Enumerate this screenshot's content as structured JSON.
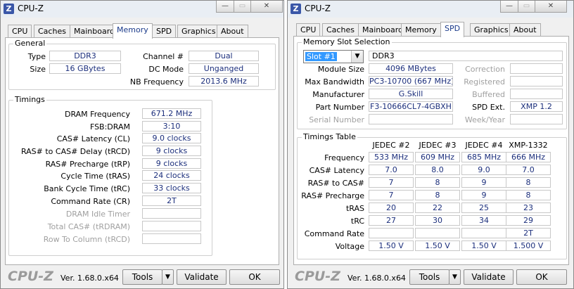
{
  "left": {
    "title": "CPU-Z",
    "tabs": [
      "CPU",
      "Caches",
      "Mainboard",
      "Memory",
      "SPD",
      "Graphics",
      "About"
    ],
    "active_tab": "Memory",
    "general": {
      "label": "General",
      "type_label": "Type",
      "type": "DDR3",
      "size_label": "Size",
      "size": "16 GBytes",
      "channel_label": "Channel #",
      "channel": "Dual",
      "dcmode_label": "DC Mode",
      "dcmode": "Unganged",
      "nbfreq_label": "NB Frequency",
      "nbfreq": "2013.6 MHz"
    },
    "timings": {
      "label": "Timings",
      "rows": [
        {
          "label": "DRAM Frequency",
          "value": "671.2 MHz"
        },
        {
          "label": "FSB:DRAM",
          "value": "3:10"
        },
        {
          "label": "CAS# Latency (CL)",
          "value": "9.0 clocks"
        },
        {
          "label": "RAS# to CAS# Delay (tRCD)",
          "value": "9 clocks"
        },
        {
          "label": "RAS# Precharge (tRP)",
          "value": "9 clocks"
        },
        {
          "label": "Cycle Time (tRAS)",
          "value": "24 clocks"
        },
        {
          "label": "Bank Cycle Time (tRC)",
          "value": "33 clocks"
        },
        {
          "label": "Command Rate (CR)",
          "value": "2T"
        },
        {
          "label": "DRAM Idle Timer",
          "value": ""
        },
        {
          "label": "Total CAS# (tRDRAM)",
          "value": ""
        },
        {
          "label": "Row To Column (tRCD)",
          "value": ""
        }
      ]
    },
    "footer": {
      "brand": "CPU-Z",
      "version": "Ver. 1.68.0.x64",
      "tools": "Tools",
      "validate": "Validate",
      "ok": "OK"
    }
  },
  "right": {
    "title": "CPU-Z",
    "tabs": [
      "CPU",
      "Caches",
      "Mainboard",
      "Memory",
      "SPD",
      "Graphics",
      "About"
    ],
    "active_tab": "SPD",
    "slot": {
      "label": "Memory Slot Selection",
      "selected": "Slot #1",
      "type": "DDR3",
      "module_size_label": "Module Size",
      "module_size": "4096 MBytes",
      "bandwidth_label": "Max Bandwidth",
      "bandwidth": "PC3-10700 (667 MHz)",
      "manufacturer_label": "Manufacturer",
      "manufacturer": "G.Skill",
      "part_label": "Part Number",
      "part": "F3-10666CL7-4GBXH",
      "serial_label": "Serial Number",
      "serial": "",
      "correction_label": "Correction",
      "correction": "",
      "registered_label": "Registered",
      "registered": "",
      "buffered_label": "Buffered",
      "buffered": "",
      "spdext_label": "SPD Ext.",
      "spdext": "XMP 1.2",
      "week_label": "Week/Year",
      "week": ""
    },
    "timings_table": {
      "label": "Timings Table",
      "headers": [
        "JEDEC #2",
        "JEDEC #3",
        "JEDEC #4",
        "XMP-1332"
      ],
      "rows": [
        {
          "label": "Frequency",
          "values": [
            "533 MHz",
            "609 MHz",
            "685 MHz",
            "666 MHz"
          ]
        },
        {
          "label": "CAS# Latency",
          "values": [
            "7.0",
            "8.0",
            "9.0",
            "7.0"
          ]
        },
        {
          "label": "RAS# to CAS#",
          "values": [
            "7",
            "8",
            "9",
            "8"
          ]
        },
        {
          "label": "RAS# Precharge",
          "values": [
            "7",
            "8",
            "9",
            "8"
          ]
        },
        {
          "label": "tRAS",
          "values": [
            "20",
            "22",
            "25",
            "23"
          ]
        },
        {
          "label": "tRC",
          "values": [
            "27",
            "30",
            "34",
            "29"
          ]
        },
        {
          "label": "Command Rate",
          "values": [
            "",
            "",
            "",
            "2T"
          ]
        },
        {
          "label": "Voltage",
          "values": [
            "1.50 V",
            "1.50 V",
            "1.50 V",
            "1.500 V"
          ]
        }
      ]
    },
    "footer": {
      "brand": "CPU-Z",
      "version": "Ver. 1.68.0.x64",
      "tools": "Tools",
      "validate": "Validate",
      "ok": "OK"
    }
  }
}
